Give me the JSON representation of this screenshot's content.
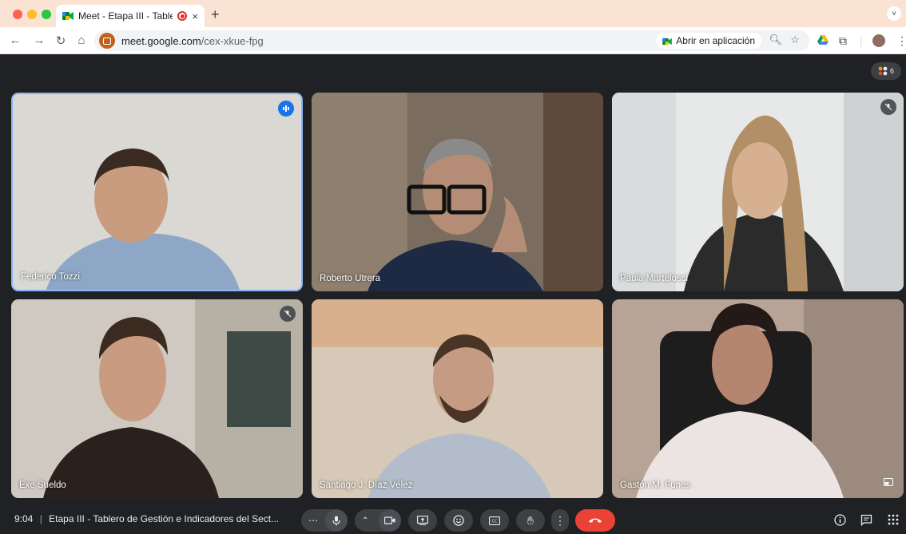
{
  "browser": {
    "tab_title": "Meet - Etapa III - Tablero",
    "new_tab": "+",
    "close": "×",
    "tab_menu": "˅",
    "url_host": "meet.google.com",
    "url_path": "/cex-xkue-fpg",
    "open_in_app": "Abrir en aplicación"
  },
  "meet": {
    "participant_count": "6",
    "participants": [
      {
        "name": "Federico Tozzi",
        "status": "speaking"
      },
      {
        "name": "Roberto Utrera",
        "status": ""
      },
      {
        "name": "Paula Martelossi",
        "status": "muted"
      },
      {
        "name": "Exe Sueldo",
        "status": "muted"
      },
      {
        "name": "Santiago J. Díaz Vélez",
        "status": ""
      },
      {
        "name": "Gastón M. Funes",
        "status": ""
      }
    ],
    "time": "9:04",
    "separator": "|",
    "meeting_title": "Etapa III - Tablero de Gestión e Indicadores del Sect..."
  },
  "colors": {
    "accent": "#8ab4f8",
    "end_call": "#ea4335",
    "background": "#202124"
  }
}
